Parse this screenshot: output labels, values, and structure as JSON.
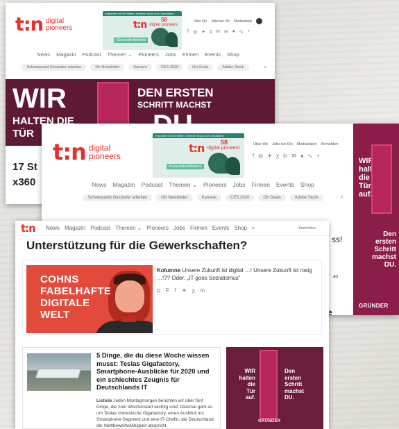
{
  "brand": {
    "mark": "t:n",
    "word1": "digital",
    "word2": "pioneers"
  },
  "magazine": {
    "strip": "Entwickelt mit 50 Seiten: Karriere-Tipps und Checklisten",
    "issue": "58",
    "label": "digital pioneers",
    "hashtag": "#GesunderArbeiten"
  },
  "toplinks": [
    "Über t3n",
    "Jobs bei t3n",
    "Mediadaten",
    "Anmelden"
  ],
  "nav": [
    "News",
    "Magazin",
    "Podcast",
    "Themen",
    "Pioneers",
    "Jobs",
    "Firmen",
    "Events",
    "Shop"
  ],
  "pills": [
    "Schwerpunkt Gesünder arbeiten",
    "t3n Newsletter",
    "Karriere",
    "CES 2020",
    "t3n Deals",
    "Adobe Stock"
  ],
  "ad_back": {
    "wir": "WIR",
    "line2": "HALTEN DIE",
    "line3": "TÜR",
    "right1": "DEN ERSTEN",
    "right2": "SCHRITT MACHST",
    "du": "DU."
  },
  "back": {
    "partial1": "17 St",
    "partial2": "x360"
  },
  "sky": {
    "l1": "WIR",
    "l2": "halten",
    "l3": "die",
    "l4": "Tür",
    "l5": "auf.",
    "r1": "Den",
    "r2": "ersten",
    "r3": "Schritt",
    "r4": "machst",
    "r5": "DU.",
    "brand": "GRÜNDER"
  },
  "mid": {
    "excl": "ss!",
    "ag": "AG",
    "e": "e"
  },
  "front": {
    "headline": "Unterstützung für die Gewerkschaften?",
    "image_lines": [
      "COHNS",
      "FABELHAFTE",
      "DIGITALE",
      "WELT"
    ],
    "kolumne_label": "Kolumne",
    "kolumne_text": "Unsere Zukunft ist digital …! Unsere Zukunft ist rosig …!?? Oder: „IT goes Sozialismus“",
    "article_title": "5 Dinge, die du diese Woche wissen musst: Teslas Gigafactory, Smartphone-Ausblicke für 2020 und ein schlechtes Zeugnis für Deutschlands IT",
    "article_label": "Listicle",
    "article_text": "Jeden Montagmorgen berichten wir über fünf Dinge, die zum Wochenstart wichtig sind. Diesmal geht es um Teslas chinesische Gigafactory, einen Ausblick ins Smartphone-Segment und eine IT-Chefin, die Deutschland die Wettbewerbsfähigkeit abspricht."
  }
}
